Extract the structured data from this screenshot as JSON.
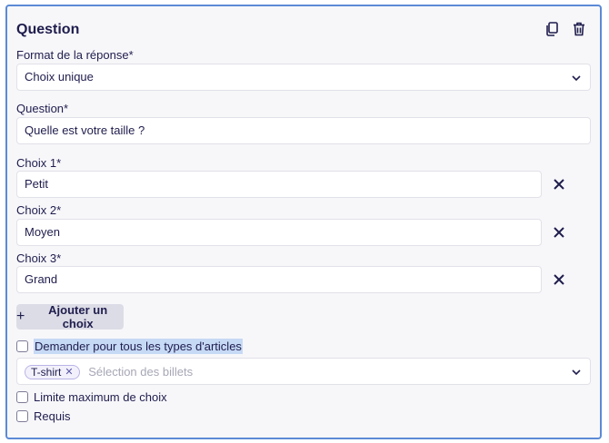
{
  "header": {
    "title": "Question",
    "duplicate_icon": "copy-icon",
    "delete_icon": "trash-icon"
  },
  "format": {
    "label": "Format de la réponse*",
    "value": "Choix unique"
  },
  "question": {
    "label": "Question*",
    "value": "Quelle est votre taille ?"
  },
  "choices": [
    {
      "label": "Choix 1*",
      "value": "Petit"
    },
    {
      "label": "Choix 2*",
      "value": "Moyen"
    },
    {
      "label": "Choix 3*",
      "value": "Grand"
    }
  ],
  "add_choice": {
    "label": "Ajouter un choix"
  },
  "ask_all": {
    "label": "Demander pour tous les types d'articles",
    "checked": false
  },
  "tickets": {
    "chip": "T-shirt",
    "placeholder": "Sélection des billets"
  },
  "max_limit": {
    "label": "Limite maximum de choix",
    "checked": false
  },
  "required": {
    "label": "Requis",
    "checked": false
  },
  "colors": {
    "accent": "#5b8ad6",
    "text": "#1f1d4d",
    "highlight": "#c6d9f5"
  }
}
